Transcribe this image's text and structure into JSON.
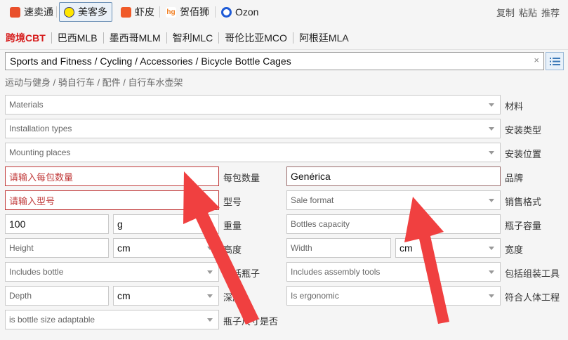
{
  "platforms": [
    "速卖通",
    "美客多",
    "虾皮",
    "贺佰狮",
    "Ozon"
  ],
  "platform_icons": [
    "aliexpress-icon",
    "mercadolibre-icon",
    "shopee-icon",
    "hebaishi-icon",
    "ozon-icon"
  ],
  "actions": [
    "复制",
    "粘贴",
    "推荐"
  ],
  "regions": [
    "跨境CBT",
    "巴西MLB",
    "墨西哥MLM",
    "智利MLC",
    "哥伦比亚MCO",
    "阿根廷MLA"
  ],
  "category": {
    "path_en": "Sports and Fitness / Cycling / Accessories / Bicycle Bottle Cages",
    "path_zh": "运动与健身 / 骑自行车 / 配件 / 自行车水壶架",
    "clear": "×"
  },
  "fields": {
    "materials": {
      "placeholder": "Materials",
      "label": "材料"
    },
    "installation_types": {
      "placeholder": "Installation types",
      "label": "安装类型"
    },
    "mounting_places": {
      "placeholder": "Mounting places",
      "label": "安装位置"
    },
    "units_per_pack": {
      "placeholder": "请输入每包数量",
      "label": "每包数量"
    },
    "brand": {
      "value": "Genérica",
      "label": "品牌"
    },
    "model": {
      "placeholder": "请输入型号",
      "label": "型号"
    },
    "sale_format": {
      "placeholder": "Sale format",
      "label": "销售格式"
    },
    "weight": {
      "value": "100",
      "unit": "g",
      "label": "重量"
    },
    "bottles_capacity": {
      "placeholder": "Bottles capacity",
      "label": "瓶子容量"
    },
    "height": {
      "placeholder": "Height",
      "unit": "cm",
      "label": "高度"
    },
    "width": {
      "placeholder": "Width",
      "unit": "cm",
      "label": "宽度"
    },
    "includes_bottle": {
      "placeholder": "Includes bottle",
      "label": "包括瓶子"
    },
    "includes_assembly_tools": {
      "placeholder": "Includes assembly tools",
      "label": "包括组装工具"
    },
    "depth": {
      "placeholder": "Depth",
      "unit": "cm",
      "label": "深度"
    },
    "is_ergonomic": {
      "placeholder": "Is ergonomic",
      "label": "符合人体工程"
    },
    "bottle_size_adaptable": {
      "placeholder": "is bottle size adaptable",
      "label": "瓶子尺寸是否"
    }
  },
  "colors": {
    "accent_red": "#d61c1c",
    "annotation_arrow": "#f04040"
  }
}
